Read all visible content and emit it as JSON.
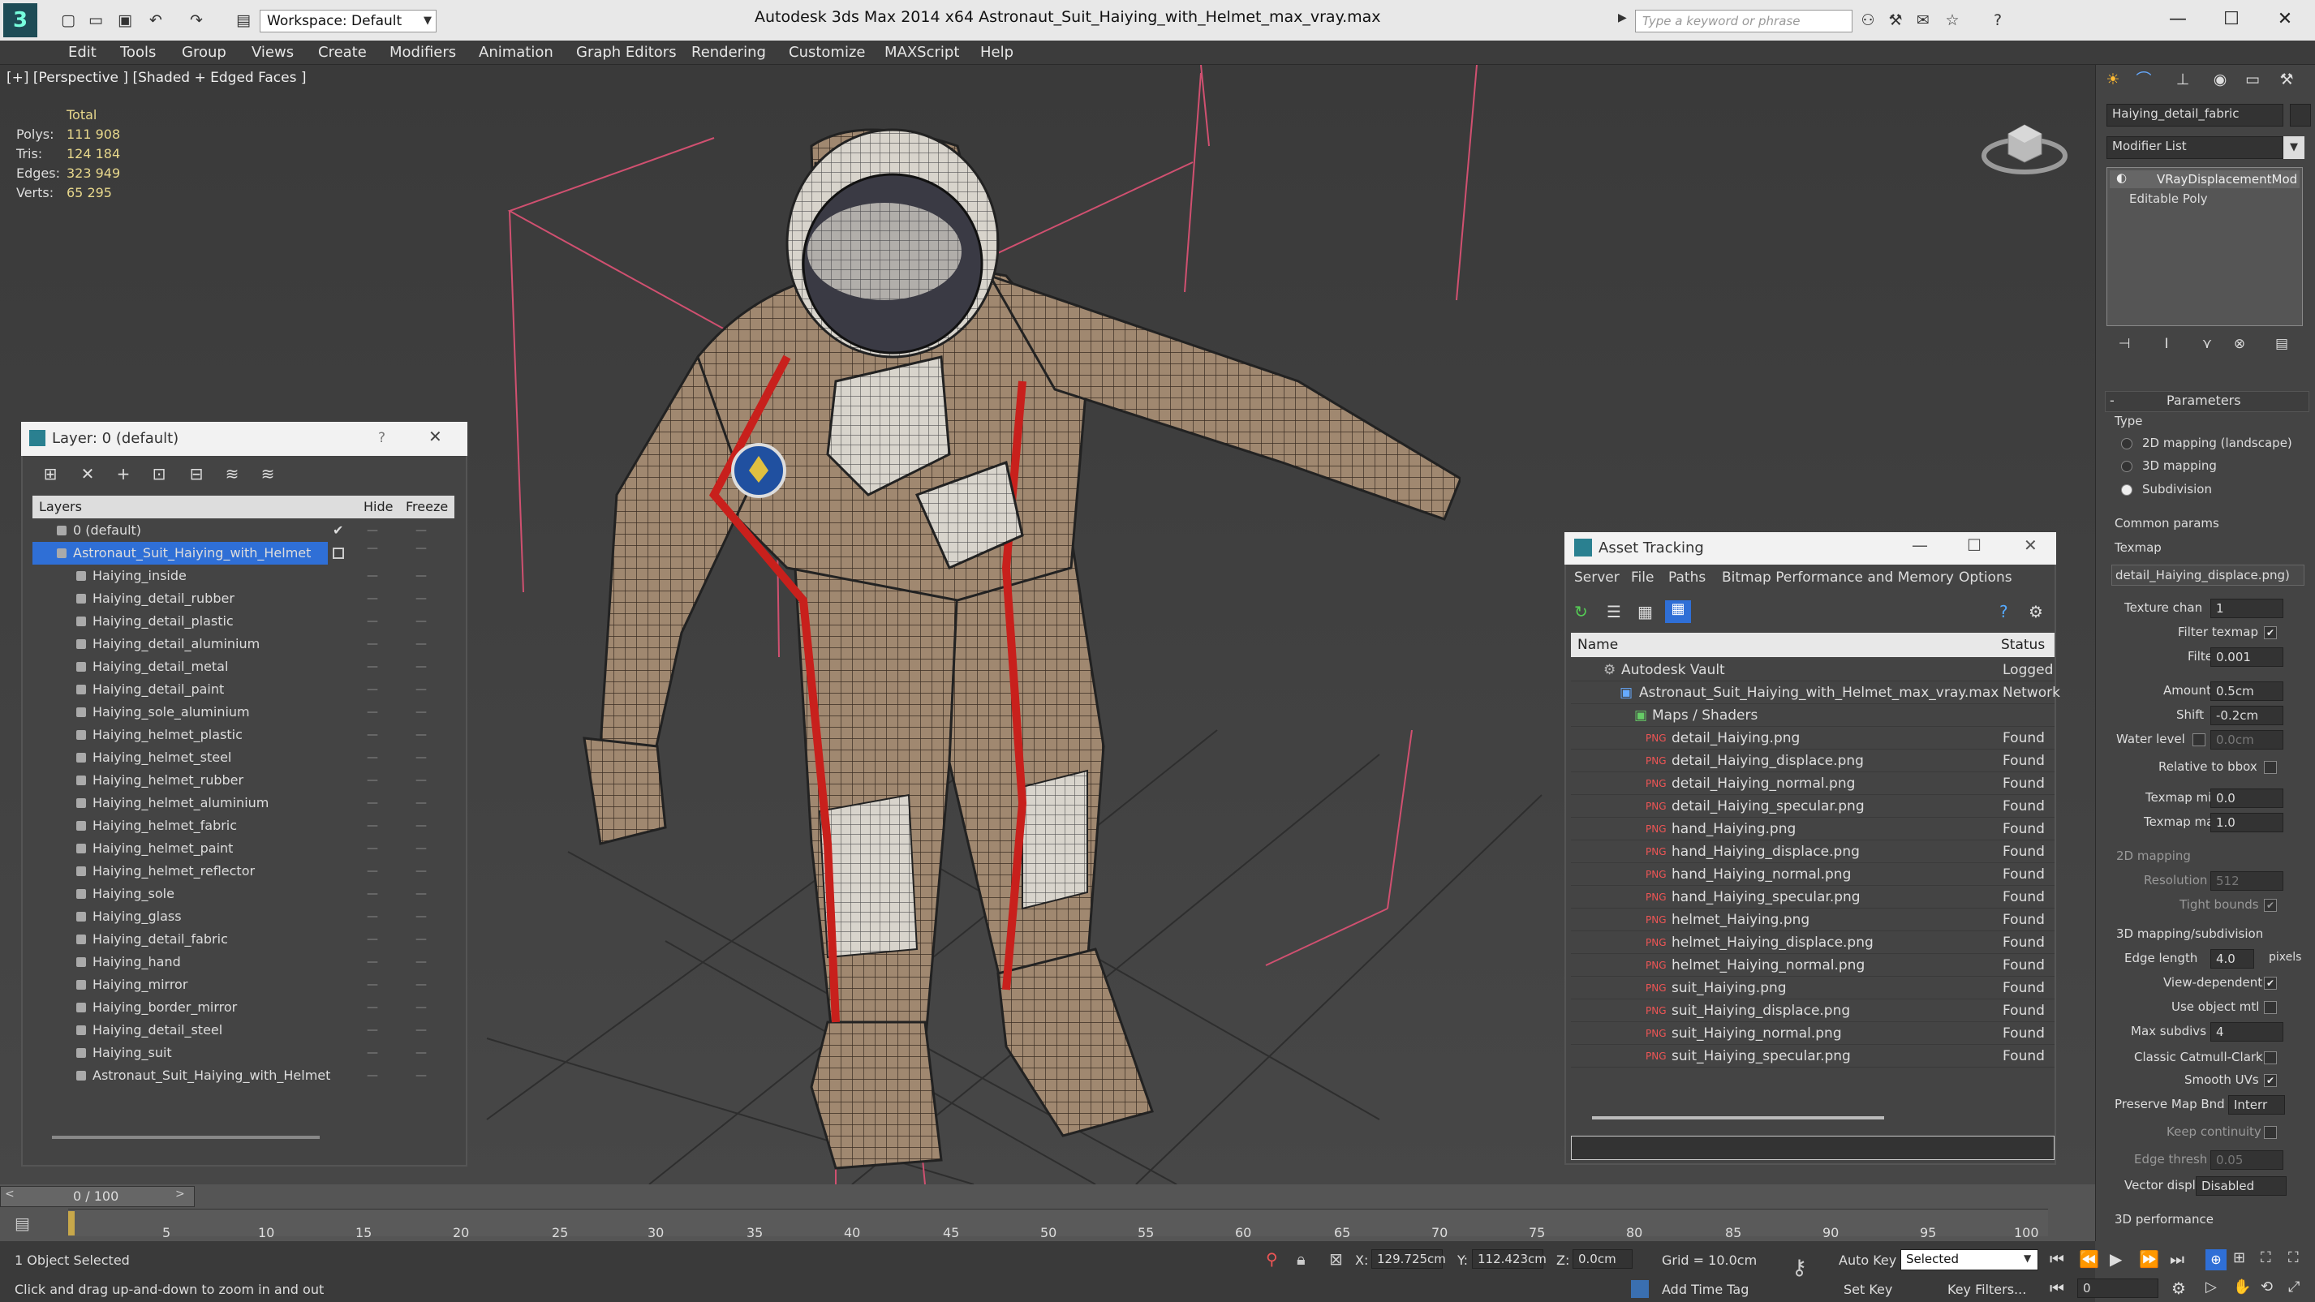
{
  "app": {
    "title": "Autodesk 3ds Max  2014 x64      Astronaut_Suit_Haiying_with_Helmet_max_vray.max",
    "workspace": "Workspace: Default",
    "search_placeholder": "Type a keyword or phrase"
  },
  "menu": [
    "Edit",
    "Tools",
    "Group",
    "Views",
    "Create",
    "Modifiers",
    "Animation",
    "Graph Editors",
    "Rendering",
    "Customize",
    "MAXScript",
    "Help"
  ],
  "viewport": {
    "label": "[+] [Perspective ] [Shaded + Edged Faces ]",
    "stats": {
      "total_label": "Total",
      "polys_label": "Polys:",
      "polys": "111 908",
      "tris_label": "Tris:",
      "tris": "124 184",
      "edges_label": "Edges:",
      "edges": "323 949",
      "verts_label": "Verts:",
      "verts": "65 295"
    }
  },
  "layer_window": {
    "title": "Layer: 0 (default)",
    "help": "?",
    "col_layers": "Layers",
    "col_hide": "Hide",
    "col_freeze": "Freeze",
    "rows": [
      "0 (default)",
      "Astronaut_Suit_Haiying_with_Helmet",
      "Haiying_inside",
      "Haiying_detail_rubber",
      "Haiying_detail_plastic",
      "Haiying_detail_aluminium",
      "Haiying_detail_metal",
      "Haiying_detail_paint",
      "Haiying_sole_aluminium",
      "Haiying_helmet_plastic",
      "Haiying_helmet_steel",
      "Haiying_helmet_rubber",
      "Haiying_helmet_aluminium",
      "Haiying_helmet_fabric",
      "Haiying_helmet_paint",
      "Haiying_helmet_reflector",
      "Haiying_sole",
      "Haiying_glass",
      "Haiying_detail_fabric",
      "Haiying_hand",
      "Haiying_mirror",
      "Haiying_border_mirror",
      "Haiying_detail_steel",
      "Haiying_suit",
      "Astronaut_Suit_Haiying_with_Helmet"
    ]
  },
  "asset_window": {
    "title": "Asset Tracking",
    "menu": [
      "Server",
      "File",
      "Paths",
      "Bitmap Performance and Memory",
      "Options"
    ],
    "col_name": "Name",
    "col_status": "Status",
    "rows": [
      {
        "name": "Autodesk Vault",
        "status": "Logged"
      },
      {
        "name": "Astronaut_Suit_Haiying_with_Helmet_max_vray.max",
        "status": "Network"
      },
      {
        "name": "Maps / Shaders",
        "status": ""
      },
      {
        "name": "detail_Haiying.png",
        "status": "Found"
      },
      {
        "name": "detail_Haiying_displace.png",
        "status": "Found"
      },
      {
        "name": "detail_Haiying_normal.png",
        "status": "Found"
      },
      {
        "name": "detail_Haiying_specular.png",
        "status": "Found"
      },
      {
        "name": "hand_Haiying.png",
        "status": "Found"
      },
      {
        "name": "hand_Haiying_displace.png",
        "status": "Found"
      },
      {
        "name": "hand_Haiying_normal.png",
        "status": "Found"
      },
      {
        "name": "hand_Haiying_specular.png",
        "status": "Found"
      },
      {
        "name": "helmet_Haiying.png",
        "status": "Found"
      },
      {
        "name": "helmet_Haiying_displace.png",
        "status": "Found"
      },
      {
        "name": "helmet_Haiying_normal.png",
        "status": "Found"
      },
      {
        "name": "suit_Haiying.png",
        "status": "Found"
      },
      {
        "name": "suit_Haiying_displace.png",
        "status": "Found"
      },
      {
        "name": "suit_Haiying_normal.png",
        "status": "Found"
      },
      {
        "name": "suit_Haiying_specular.png",
        "status": "Found"
      }
    ]
  },
  "command_panel": {
    "object_name": "Haiying_detail_fabric",
    "modifier_list": "Modifier List",
    "stack": [
      "VRayDisplacementMod",
      "Editable Poly"
    ],
    "parameters": "Parameters",
    "type_label": "Type",
    "type_options": [
      "2D mapping (landscape)",
      "3D mapping",
      "Subdivision"
    ],
    "common_params": "Common params",
    "texmap_label": "Texmap",
    "texmap_value": "detail_Haiying_displace.png)",
    "texture_chan_label": "Texture chan",
    "texture_chan": "1",
    "filter_texmap_label": "Filter texmap",
    "filter_blur_label": "Filter blur",
    "filter_blur": "0.001",
    "amount_label": "Amount",
    "amount": "0.5cm",
    "shift_label": "Shift",
    "shift": "-0.2cm",
    "water_level_label": "Water level",
    "water_level": "0.0cm",
    "relative_bbox_label": "Relative to bbox",
    "texmap_min_label": "Texmap min",
    "texmap_min": "0.0",
    "texmap_max_label": "Texmap max",
    "texmap_max": "1.0",
    "mapping2d_label": "2D mapping",
    "resolution_label": "Resolution",
    "resolution": "512",
    "tight_bounds_label": "Tight bounds",
    "mapping3d_label": "3D mapping/subdivision",
    "edge_length_label": "Edge length",
    "edge_length": "4.0",
    "pixels_label": "pixels",
    "view_dependent_label": "View-dependent",
    "use_object_mtl_label": "Use object mtl",
    "max_subdivs_label": "Max subdivs",
    "max_subdivs": "4",
    "classic_cc_label": "Classic Catmull-Clark",
    "smooth_uvs_label": "Smooth UVs",
    "preserve_map_label": "Preserve Map Bnd",
    "preserve_map": "Interr",
    "keep_continuity_label": "Keep continuity",
    "edge_thresh_label": "Edge thresh",
    "edge_thresh": "0.05",
    "vector_displ_label": "Vector displ",
    "vector_displ": "Disabled",
    "perf_label": "3D performance"
  },
  "timeline": {
    "frame": "0 / 100",
    "ticks": [
      "0",
      "5",
      "10",
      "15",
      "20",
      "25",
      "30",
      "35",
      "40",
      "45",
      "50",
      "55",
      "60",
      "65",
      "70",
      "75",
      "80",
      "85",
      "90",
      "95",
      "100"
    ]
  },
  "status": {
    "selection": "1 Object Selected",
    "prompt": "Click and drag up-and-down to zoom in and out",
    "x_label": "X:",
    "x": "129.725cm",
    "y_label": "Y:",
    "y": "112.423cm",
    "z_label": "Z:",
    "z": "0.0cm",
    "grid": "Grid = 10.0cm",
    "add_time_tag": "Add Time Tag",
    "auto_key": "Auto Key",
    "set_key": "Set Key",
    "selected": "Selected",
    "key_filters": "Key Filters...",
    "frame_field": "0"
  },
  "colors": {
    "selection_blue": "#2f6fd6",
    "mesh_tan": "#a08870",
    "suit_red": "#c8201c",
    "bbox_pink": "#d05070"
  }
}
